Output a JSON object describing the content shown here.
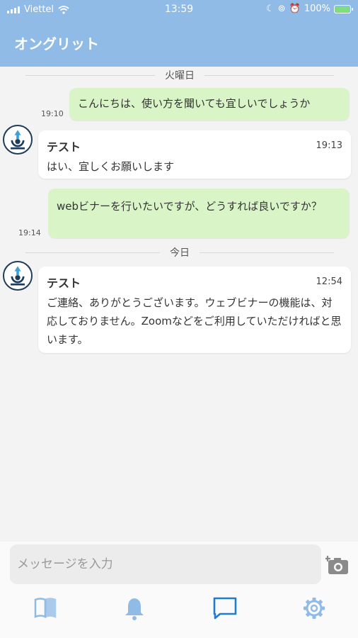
{
  "status_bar": {
    "carrier": "Viettel",
    "time": "13:59",
    "battery": "100%"
  },
  "header": {
    "title": "オングリット"
  },
  "chat": {
    "date_separators": [
      "火曜日",
      "今日"
    ],
    "messages": [
      {
        "direction": "out",
        "text": "こんにちは、使い方を聞いても宜しいでしょうか",
        "time": "19:10"
      },
      {
        "direction": "in",
        "sender": "テスト",
        "text": "はい、宜しくお願いします",
        "time": "19:13"
      },
      {
        "direction": "out",
        "text": "webビナーを行いたいですが、どうすれば良いですか？",
        "time": "19:14"
      },
      {
        "direction": "in",
        "sender": "テスト",
        "text": "ご連絡、ありがとうございます。ウェブビナーの機能は、対応しておりません。Zoomなどをご利用していただければと思います。",
        "time": "12:54"
      }
    ]
  },
  "input": {
    "placeholder": "メッセージを入力"
  },
  "tabs": [
    {
      "name": "book-icon",
      "active": false
    },
    {
      "name": "bell-icon",
      "active": false
    },
    {
      "name": "chat-icon",
      "active": true
    },
    {
      "name": "gear-icon",
      "active": false
    }
  ],
  "colors": {
    "header_bg": "#8fbbe6",
    "outgoing_bubble": "#d9f4c7",
    "tab_icon": "#8fbbe6",
    "tab_active": "#1f7ccf"
  }
}
